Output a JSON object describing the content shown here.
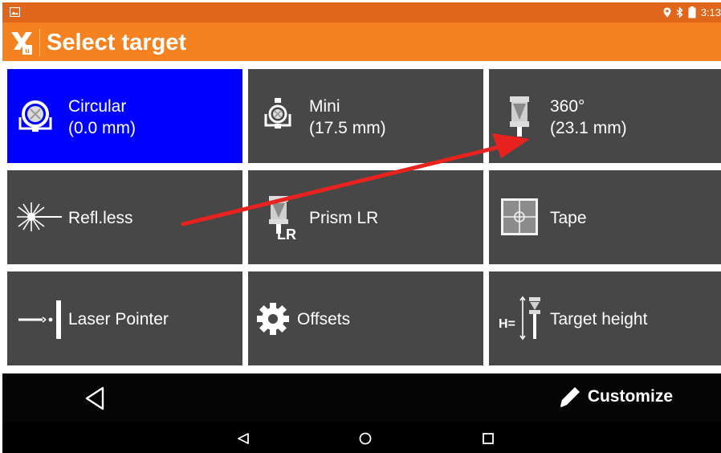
{
  "status": {
    "time": "3:13",
    "icons": [
      "image-icon",
      "location-icon",
      "bluetooth-icon",
      "battery-icon"
    ]
  },
  "appbar": {
    "title": "Select target",
    "logo_icon": "app-logo-icon",
    "logo_letter": "u"
  },
  "tiles": [
    {
      "line1": "Circular",
      "line2": "(0.0 mm)",
      "icon": "circular-prism-icon",
      "selected": true
    },
    {
      "line1": "Mini",
      "line2": "(17.5 mm)",
      "icon": "mini-prism-icon"
    },
    {
      "line1": "360°",
      "line2": "(23.1 mm)",
      "icon": "prism-360-icon"
    },
    {
      "line1": "Refl.less",
      "icon": "reflectorless-icon"
    },
    {
      "line1": "Prism LR",
      "icon": "prism-lr-icon",
      "icon_text": "LR"
    },
    {
      "line1": "Tape",
      "icon": "tape-target-icon"
    },
    {
      "line1": "Laser Pointer",
      "icon": "laser-pointer-icon"
    },
    {
      "line1": "Offsets",
      "icon": "gear-icon"
    },
    {
      "line1": "Target height",
      "icon": "target-height-icon",
      "icon_text": "H="
    }
  ],
  "bottombar": {
    "back_icon": "back-icon",
    "customize_label": "Customize",
    "customize_icon": "pencil-icon"
  },
  "navbar": {
    "icons": [
      "nav-back-icon",
      "nav-home-icon",
      "nav-recents-icon"
    ]
  },
  "colors": {
    "statusbar": "#e0661b",
    "appbar": "#f58220",
    "tile": "#474747",
    "selected_tile": "#0000ff",
    "annotation_arrow": "#e8231f"
  }
}
